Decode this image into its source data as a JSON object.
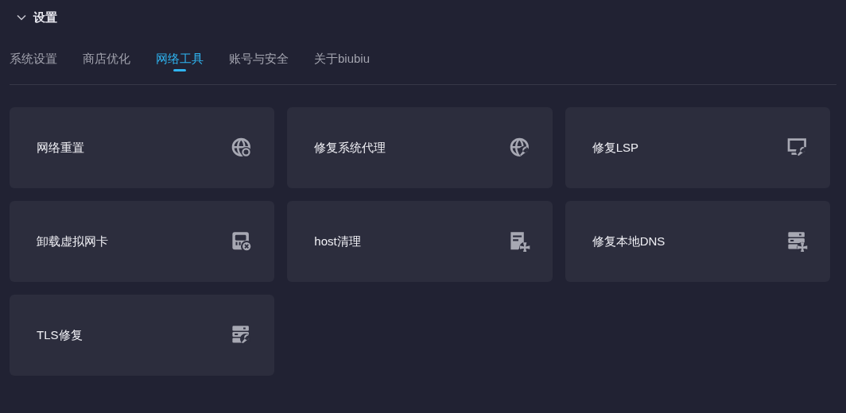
{
  "section": {
    "title": "设置",
    "expanded": true
  },
  "tabs": [
    {
      "label": "系统设置",
      "selected": false
    },
    {
      "label": "商店优化",
      "selected": false
    },
    {
      "label": "网络工具",
      "selected": true
    },
    {
      "label": "账号与安全",
      "selected": false
    },
    {
      "label": "关于biubiu",
      "selected": false
    }
  ],
  "tools": [
    {
      "label": "网络重置",
      "kind": "globe-refresh"
    },
    {
      "label": "修复系统代理",
      "kind": "globe-wrench"
    },
    {
      "label": "修复LSP",
      "kind": "monitor-wrench"
    },
    {
      "label": "卸载虚拟网卡",
      "kind": "card-remove"
    },
    {
      "label": "host清理",
      "kind": "document-fan"
    },
    {
      "label": "修复本地DNS",
      "kind": "server-fan"
    },
    {
      "label": "TLS修复",
      "kind": "server-wrench"
    }
  ]
}
